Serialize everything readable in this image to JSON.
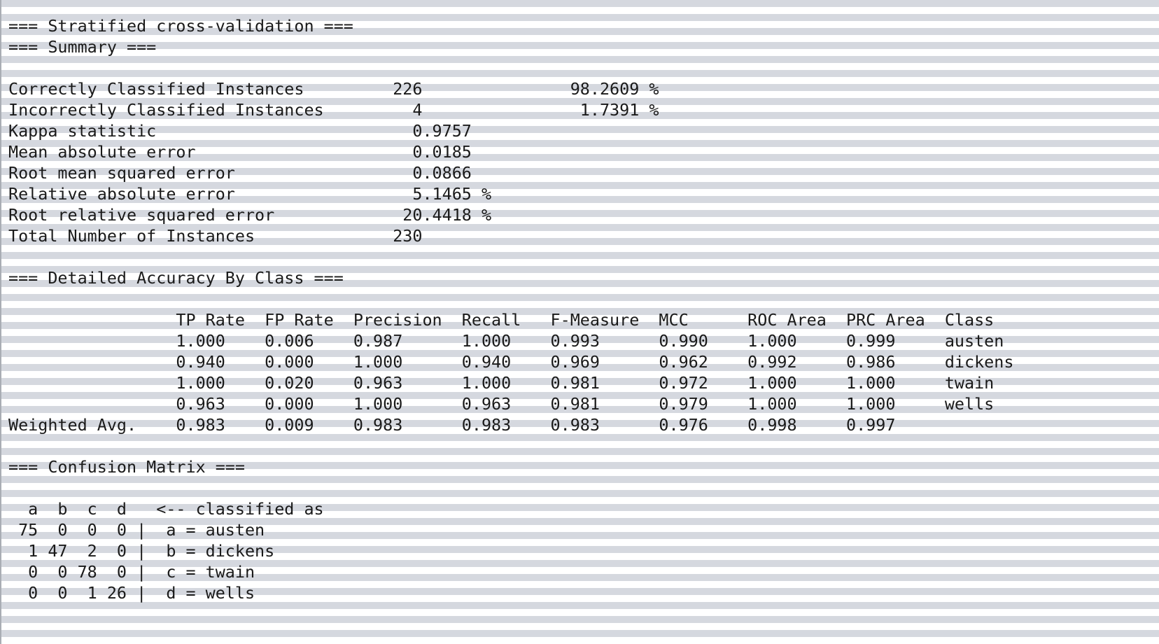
{
  "output": {
    "lines": [
      "=== Stratified cross-validation ===",
      "=== Summary ===",
      "",
      "Correctly Classified Instances         226               98.2609 %",
      "Incorrectly Classified Instances         4                1.7391 %",
      "Kappa statistic                          0.9757",
      "Mean absolute error                      0.0185",
      "Root mean squared error                  0.0866",
      "Relative absolute error                  5.1465 %",
      "Root relative squared error             20.4418 %",
      "Total Number of Instances              230     ",
      "",
      "=== Detailed Accuracy By Class ===",
      "",
      "                 TP Rate  FP Rate  Precision  Recall   F-Measure  MCC      ROC Area  PRC Area  Class",
      "                 1.000    0.006    0.987      1.000    0.993      0.990    1.000     0.999     austen",
      "                 0.940    0.000    1.000      0.940    0.969      0.962    0.992     0.986     dickens",
      "                 1.000    0.020    0.963      1.000    0.981      0.972    1.000     1.000     twain",
      "                 0.963    0.000    1.000      0.963    0.981      0.979    1.000     1.000     wells",
      "Weighted Avg.    0.983    0.009    0.983      0.983    0.983      0.976    0.998     0.997     ",
      "",
      "=== Confusion Matrix ===",
      "",
      "  a  b  c  d   <-- classified as",
      " 75  0  0  0 |  a = austen",
      "  1 47  2  0 |  b = dickens",
      "  0  0 78  0 |  c = twain",
      "  0  0  1 26 |  d = wells"
    ]
  },
  "colors": {
    "stripe_gray": "#d5d8df",
    "stripe_white": "#ffffff",
    "text": "#1a1a1a",
    "left_border": "#a9adb4"
  }
}
